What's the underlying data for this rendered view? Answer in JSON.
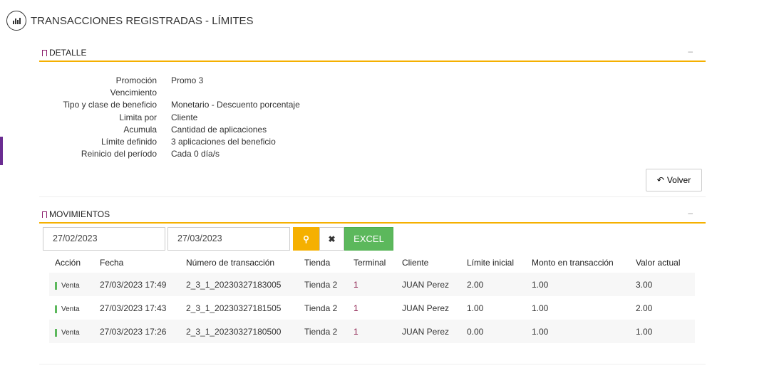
{
  "header": {
    "title": "TRANSACCIONES REGISTRADAS - LÍMITES",
    "icon": "bar-chart-icon"
  },
  "detalle": {
    "title": "DETALLE",
    "minimize": "–",
    "fields": [
      {
        "label": "Promoción",
        "value": "Promo 3"
      },
      {
        "label": "Vencimiento",
        "value": ""
      },
      {
        "label": "Tipo y clase de beneficio",
        "value": "Monetario - Descuento porcentaje"
      },
      {
        "label": "Limita por",
        "value": "Cliente"
      },
      {
        "label": "Acumula",
        "value": "Cantidad de aplicaciones"
      },
      {
        "label": "Límite definido",
        "value": "3 aplicaciones del beneficio"
      },
      {
        "label": "Reinicio del período",
        "value": "Cada 0 día/s"
      }
    ],
    "volver": "Volver"
  },
  "movimientos": {
    "title": "MOVIMIENTOS",
    "minimize": "–",
    "date_from": "27/02/2023",
    "date_to": "27/03/2023",
    "excel": "EXCEL",
    "columns": [
      "Acción",
      "Fecha",
      "Número de transacción",
      "Tienda",
      "Terminal",
      "Cliente",
      "Límite inicial",
      "Monto en transacción",
      "Valor actual"
    ],
    "rows": [
      [
        "Venta",
        "27/03/2023 17:49",
        "2_3_1_20230327183005",
        "Tienda 2",
        "1",
        "JUAN Perez",
        "2.00",
        "1.00",
        "3.00"
      ],
      [
        "Venta",
        "27/03/2023 17:43",
        "2_3_1_20230327181505",
        "Tienda 2",
        "1",
        "JUAN Perez",
        "1.00",
        "1.00",
        "2.00"
      ],
      [
        "Venta",
        "27/03/2023 17:26",
        "2_3_1_20230327180500",
        "Tienda 2",
        "1",
        "JUAN Perez",
        "0.00",
        "1.00",
        "1.00"
      ]
    ]
  },
  "colors": {
    "accent": "#f5b000",
    "excel": "#5cb85c",
    "purple": "#6a2c91"
  }
}
